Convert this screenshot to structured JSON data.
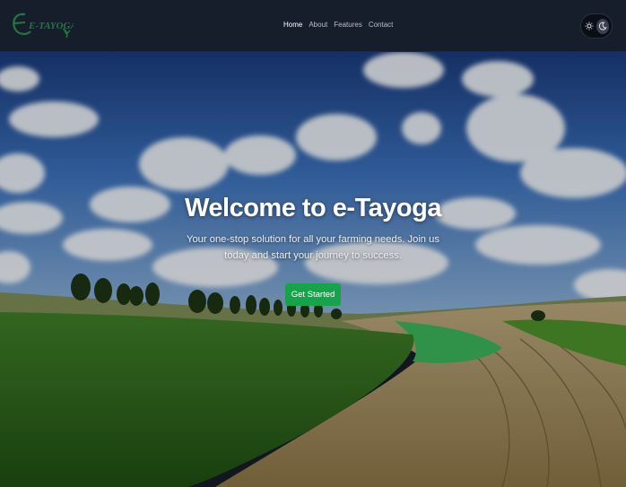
{
  "nav": {
    "logo_text": "E-TAYOGA",
    "links": [
      {
        "label": "Home",
        "active": true
      },
      {
        "label": "About",
        "active": false
      },
      {
        "label": "Features",
        "active": false
      },
      {
        "label": "Contact",
        "active": false
      }
    ]
  },
  "theme_toggle": {
    "options": [
      "sun-icon",
      "moon-icon"
    ],
    "selected": "dark"
  },
  "hero": {
    "title": "Welcome to e-Tayoga",
    "subtitle": "Your one-stop solution for all your farming needs. Join us today and start your journey to success.",
    "cta_label": "Get Started"
  },
  "colors": {
    "navbar_bg": "#161d2b",
    "accent_green": "#16a34a",
    "logo_green": "#1f7a3c"
  }
}
